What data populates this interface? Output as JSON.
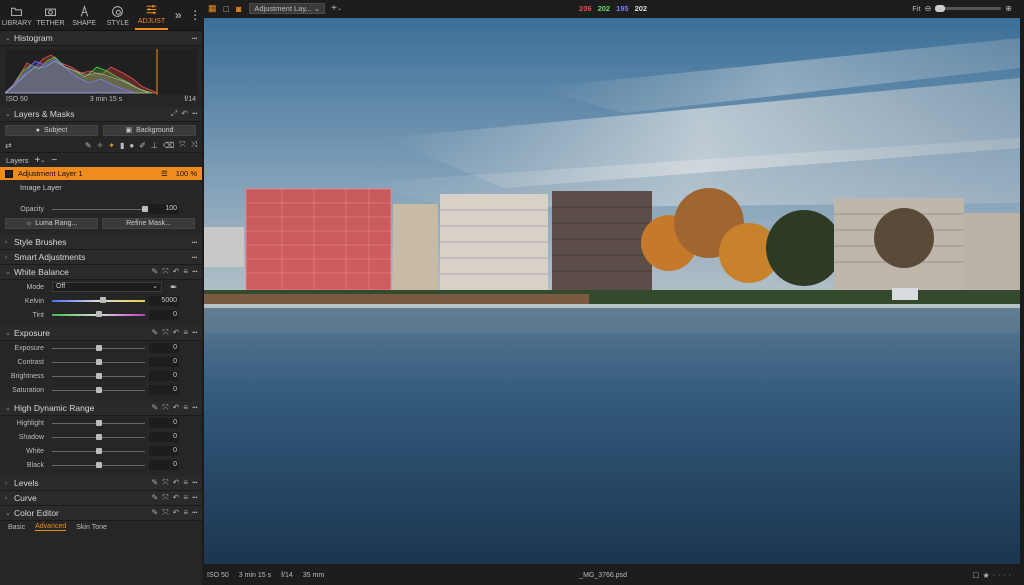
{
  "tabs": [
    {
      "label": "LIBRARY"
    },
    {
      "label": "TETHER"
    },
    {
      "label": "SHAPE"
    },
    {
      "label": "STYLE"
    },
    {
      "label": "ADJUST"
    }
  ],
  "histogram": {
    "title": "Histogram",
    "iso": "ISO 50",
    "time": "3 min 15 s",
    "aperture": "f/14"
  },
  "layers_masks": {
    "title": "Layers & Masks",
    "subject": "Subject",
    "background": "Background",
    "layers_label": "Layers",
    "active_layer": "Adjustment Layer 1",
    "active_pct": "100 %",
    "image_layer": "Image Layer",
    "opacity_label": "Opacity",
    "opacity_value": "100",
    "luma": "Luma Rang...",
    "refine": "Refine Mask..."
  },
  "sections": {
    "style_brushes": "Style Brushes",
    "smart": "Smart Adjustments",
    "wb": "White Balance",
    "exposure": "Exposure",
    "hdr": "High Dynamic Range",
    "levels": "Levels",
    "curve": "Curve",
    "color_editor": "Color Editor"
  },
  "wb": {
    "mode_label": "Mode",
    "mode_value": "Off",
    "kelvin_label": "Kelvin",
    "kelvin_value": "5000",
    "tint_label": "Tint",
    "tint_value": "0"
  },
  "exposure": [
    {
      "label": "Exposure",
      "value": "0"
    },
    {
      "label": "Contrast",
      "value": "0"
    },
    {
      "label": "Brightness",
      "value": "0"
    },
    {
      "label": "Saturation",
      "value": "0"
    }
  ],
  "hdr": [
    {
      "label": "Highlight",
      "value": "0"
    },
    {
      "label": "Shadow",
      "value": "0"
    },
    {
      "label": "White",
      "value": "0"
    },
    {
      "label": "Black",
      "value": "0"
    }
  ],
  "color_editor_tabs": [
    "Basic",
    "Advanced",
    "Skin Tone"
  ],
  "topbar": {
    "layer_select": "Adjustment Lay...",
    "r": "206",
    "g": "202",
    "b": "195",
    "k": "202",
    "zoom": "Fit"
  },
  "bottombar": {
    "iso": "ISO 50",
    "time": "3 min 15 s",
    "aperture": "f/14",
    "focal": "35 mm",
    "filename": "_MG_3766.psd"
  },
  "colors": {
    "accent": "#f08c1e",
    "r": "#e05050",
    "g": "#6cd66c",
    "b": "#7070ff"
  }
}
